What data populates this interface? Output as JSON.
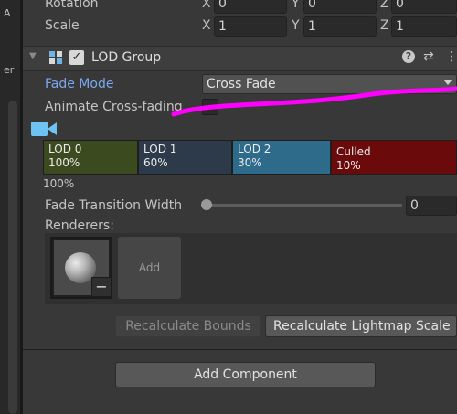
{
  "left_panel": {
    "char_top": "A",
    "char_mid": "er"
  },
  "transform": {
    "rotation_label": "Rotation",
    "scale_label": "Scale",
    "rotation": {
      "x_axis": "X",
      "x": "0",
      "y_axis": "Y",
      "y": "0",
      "z_axis": "Z",
      "z": "0"
    },
    "scale": {
      "x_axis": "X",
      "x": "1",
      "y_axis": "Y",
      "y": "1",
      "z_axis": "Z",
      "z": "1"
    }
  },
  "component": {
    "title": "LOD Group",
    "enabled": true,
    "checkbox_glyph": "✓",
    "fold_glyph": "▼",
    "help_glyph": "?",
    "presets_glyph": "⇄",
    "menu_glyph": "⋮"
  },
  "fade_mode": {
    "label": "Fade Mode",
    "value": "Cross Fade"
  },
  "animate_crossfading": {
    "label": "Animate Cross-fading"
  },
  "lods": [
    {
      "name": "LOD 0",
      "percent": "100%",
      "color": "#3c4a1f"
    },
    {
      "name": "LOD 1",
      "percent": "60%",
      "color": "#2c3a4a"
    },
    {
      "name": "LOD 2",
      "percent": "30%",
      "color": "#2e6a8a"
    },
    {
      "name": "Culled",
      "percent": "10%",
      "color": "#6a0a0a"
    }
  ],
  "lod_bar_caption": "100%",
  "fade_transition": {
    "label": "Fade Transition Width",
    "value": "0",
    "level": 0
  },
  "renderers": {
    "label": "Renderers:",
    "add_label": "Add",
    "remove_glyph": "−"
  },
  "buttons": {
    "recalc_bounds": "Recalculate Bounds",
    "recalc_lightmap": "Recalculate Lightmap Scale",
    "add_component": "Add Component"
  },
  "accent_colors": {
    "label_highlight": "#7aa8f0",
    "annotation_stroke": "#ff00ff"
  }
}
